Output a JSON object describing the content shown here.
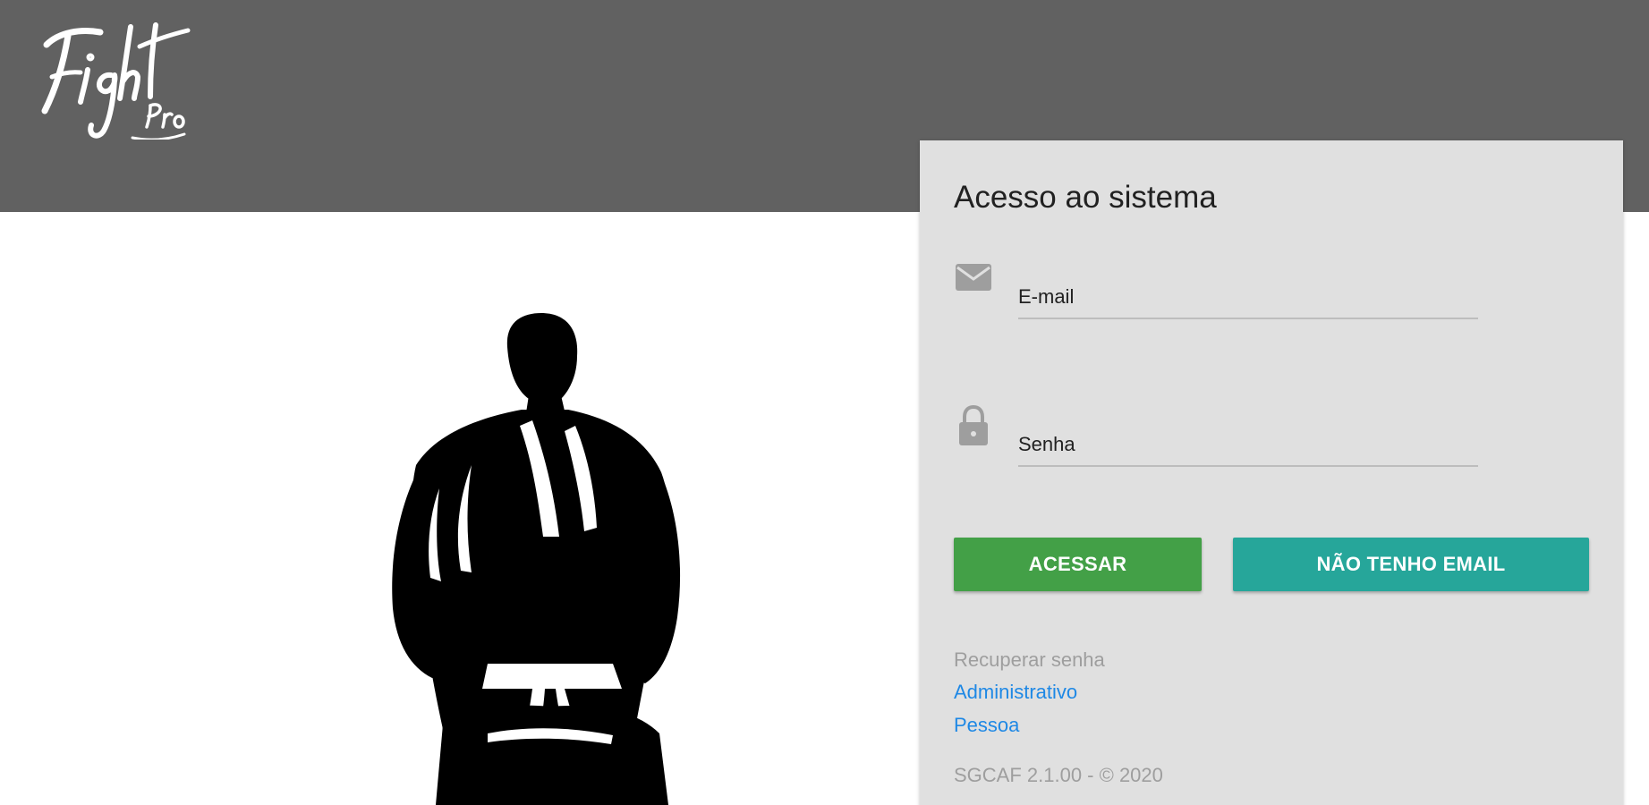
{
  "header": {
    "logo_text": "Fight Pro",
    "background_color": "#616161"
  },
  "hero": {
    "image": "jiu-jitsu-fighter-silhouette"
  },
  "login": {
    "title": "Acesso ao sistema",
    "email": {
      "icon": "envelope-icon",
      "placeholder": "E-mail",
      "value": ""
    },
    "password": {
      "icon": "lock-icon",
      "placeholder": "Senha",
      "value": ""
    },
    "buttons": {
      "login_label": "ACESSAR",
      "no_email_label": "NÃO TENHO EMAIL"
    },
    "recover": {
      "label": "Recuperar senha",
      "admin_link": "Administrativo",
      "person_link": "Pessoa"
    },
    "footer": "SGCAF 2.1.00 - © 2020"
  },
  "colors": {
    "card_background": "#e0e0e0",
    "login_button": "#43a047",
    "no_email_button": "#26a69a",
    "link": "#1e88e5",
    "muted_text": "#9e9e9e"
  }
}
